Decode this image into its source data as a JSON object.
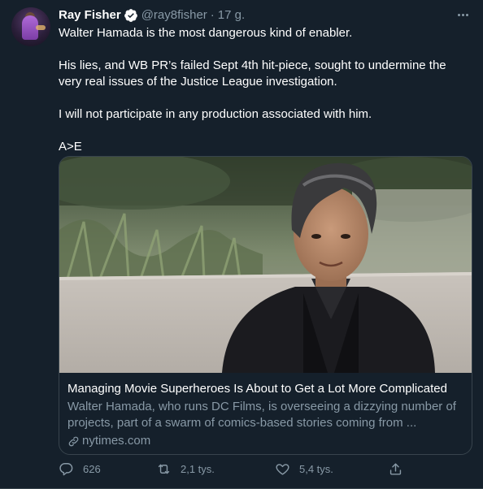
{
  "tweet": {
    "author_name": "Ray Fisher",
    "handle": "@ray8fisher",
    "separator": "·",
    "time": "17 g.",
    "paragraphs": [
      "Walter Hamada is the most dangerous kind of enabler.",
      "His lies, and WB PR’s failed Sept 4th hit-piece, sought to undermine the very real issues of the Justice League investigation.",
      "I will not participate in any production associated with him.",
      "A>E"
    ]
  },
  "card": {
    "title": "Managing Movie Superheroes Is About to Get a Lot More Complicated",
    "description": "Walter Hamada, who runs DC Films, is overseeing a dizzying number of projects, part of a swarm of comics-based stories coming from ...",
    "domain": "nytimes.com"
  },
  "actions": {
    "replies": "626",
    "retweets": "2,1 tys.",
    "likes": "5,4 tys."
  },
  "icons": {
    "verified": "verified-badge-icon",
    "more": "more-dots-icon",
    "reply": "reply-icon",
    "retweet": "retweet-icon",
    "like": "heart-icon",
    "share": "share-icon",
    "link": "link-icon"
  },
  "colors": {
    "background": "#15202b",
    "border": "#38444d",
    "secondary_text": "#8899a6",
    "verified": "#ffffff"
  }
}
